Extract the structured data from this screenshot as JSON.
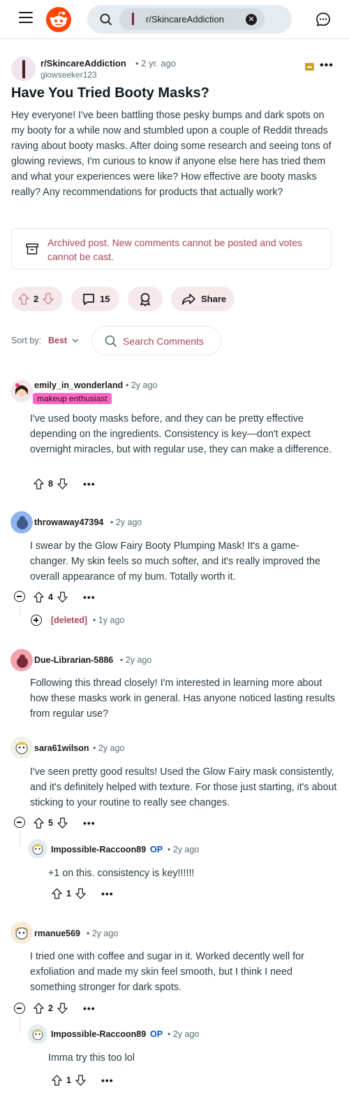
{
  "header": {
    "search_chip": "r/SkincareAddiction"
  },
  "post": {
    "subreddit": "r/SkincareAddiction",
    "time": "• 2 yr. ago",
    "author": "glowseeker123",
    "title": "Have You Tried Booty Masks?",
    "body": "Hey everyone! I've been battling those pesky bumps and dark spots on my booty for a while now and stumbled upon a couple of Reddit threads raving about booty masks. After doing some research and seeing tons of glowing reviews, I'm curious to know if anyone else here has tried them and what your experiences were like? How effective are booty masks really? Any recommendations for products that actually work?",
    "archived_notice": "Archived post. New comments cannot be posted and votes cannot be cast.",
    "votes": "2",
    "comments": "15",
    "share_label": "Share"
  },
  "sort": {
    "label": "Sort by:",
    "value": "Best",
    "search_placeholder": "Search Comments"
  },
  "comments": [
    {
      "user": "emily_in_wonderland",
      "time": "• 2y ago",
      "flair": "makeup enthusiast",
      "body": "I've used booty masks before, and they can be pretty effective depending on the ingredients. Consistency is key—don't expect overnight miracles, but with regular use, they can make a difference.",
      "votes": "8"
    },
    {
      "user": "throwaway47394",
      "time": "• 2y ago",
      "body": "I swear by the Glow Fairy Booty Plumping Mask! It's a game-changer. My skin feels so much softer, and it's really improved the overall appearance of my bum. Totally worth it.",
      "votes": "4",
      "deleted_reply": {
        "user": "[deleted]",
        "time": "• 1y ago"
      }
    },
    {
      "user": "Due-Librarian-5886",
      "time": "• 2y ago",
      "body": "Following this thread closely! I'm interested in learning more about how these masks work in general. Has anyone noticed lasting results from regular use?"
    },
    {
      "user": "sara61wilson",
      "time": "• 2y ago",
      "body": "I've seen pretty good results! Used the Glow Fairy mask consistently, and it's definitely helped with texture. For those just starting, it's about sticking to your routine to really see changes.",
      "votes": "5",
      "reply": {
        "user": "Impossible-Raccoon89",
        "op": "OP",
        "time": "• 2y ago",
        "body": "+1 on this. consistency is key!!!!!!",
        "votes": "1"
      }
    },
    {
      "user": "rmanue569",
      "time": "• 2y ago",
      "body": "I tried one with coffee and sugar in it. Worked decently well for exfoliation and made my skin feel smooth, but I think I need something stronger for dark spots.",
      "votes": "2",
      "reply": {
        "user": "Impossible-Raccoon89",
        "op": "OP",
        "time": "• 2y ago",
        "body": "Imma try this too lol",
        "votes": "1"
      }
    }
  ],
  "colors": {
    "accent": "#a8475c",
    "pill_bg": "#f6e9ec",
    "flair_bg": "#ff66c4",
    "op_blue": "#0a54c6",
    "reddit_orange": "#ff4500"
  }
}
